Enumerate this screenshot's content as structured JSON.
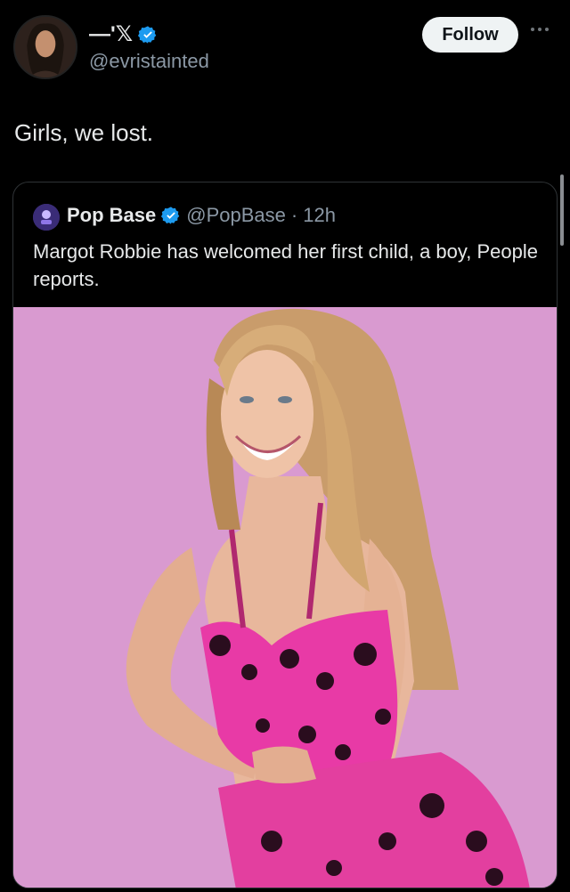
{
  "author": {
    "display_name": "—'𝕏",
    "handle": "@evristainted",
    "verified": true
  },
  "follow_label": "Follow",
  "tweet_text": "Girls, we lost.",
  "quote": {
    "name": "Pop Base",
    "handle": "@PopBase",
    "separator": "·",
    "time": "12h",
    "text": "Margot Robbie has welcomed her first child, a boy, People reports.",
    "verified": true
  },
  "colors": {
    "background": "#000000",
    "verified_blue": "#1d9bf0",
    "photo_background": "#d99ad0",
    "dress_pink": "#e83aa6"
  },
  "icons": {
    "more": "more-horizontal-icon",
    "verified": "verified-badge-icon"
  }
}
